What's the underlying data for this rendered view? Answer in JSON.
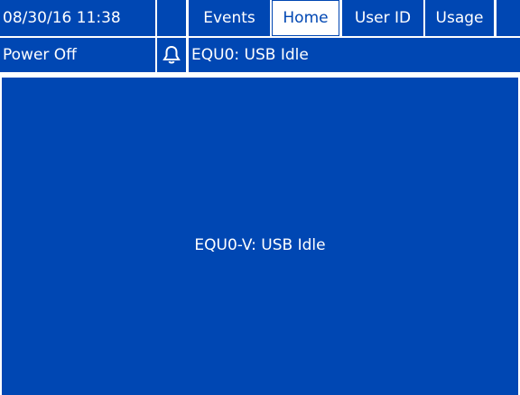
{
  "header": {
    "datetime": "08/30/16 11:38",
    "tabs": [
      {
        "label": "Events",
        "active": false
      },
      {
        "label": "Home",
        "active": true
      },
      {
        "label": "User ID",
        "active": false
      },
      {
        "label": "Usage",
        "active": false
      }
    ]
  },
  "status": {
    "system_state": "Power Off",
    "alarm_icon": "bell-icon",
    "message": "EQU0: USB Idle"
  },
  "main": {
    "message": "EQU0-V: USB Idle"
  },
  "colors": {
    "background": "#0047b3",
    "text": "#ffffff",
    "active_tab_bg": "#ffffff",
    "active_tab_text": "#0047b3"
  }
}
